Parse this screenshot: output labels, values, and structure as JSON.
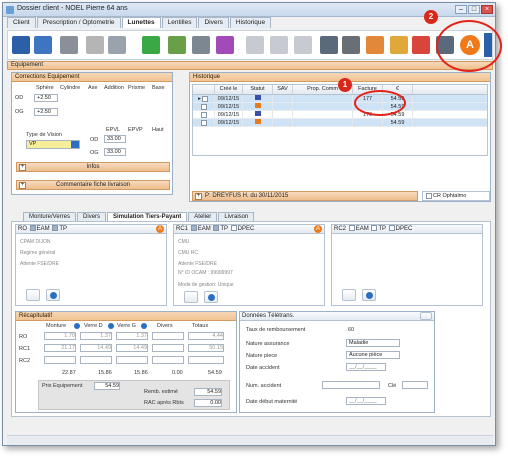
{
  "window": {
    "title": "Dossier client - NOEL Pierre 64 ans"
  },
  "tabs": [
    "Client",
    "Prescription / Optometrie",
    "Lunettes",
    "Lentilles",
    "Divers",
    "Historique"
  ],
  "equipment": {
    "label": "Equipement"
  },
  "corrections": {
    "title": "Corrections Equipement",
    "cols": [
      "Sphère",
      "Cylindre",
      "Axe",
      "Addition",
      "Prisme",
      "Base"
    ],
    "od": "OD",
    "og": "OG",
    "od_sphere": "+2.50",
    "og_sphere": "+2.50",
    "vision_label": "Type de Vision",
    "vision_value": "VP",
    "epvl": "EPVL",
    "epvp": "EPVP",
    "haut": "Haut",
    "od_epvl": "33.00",
    "og_epvl": "33.00",
    "infos": "Infos",
    "comment": "Commentaire fiche livraison"
  },
  "historique": {
    "title": "Historique",
    "cols": [
      "Créé le",
      "Statut",
      "SAV",
      "Prop. Comm",
      "Facture",
      "€"
    ],
    "rows": [
      {
        "date": "09/12/15",
        "facture": "177",
        "amount": "54.59"
      },
      {
        "date": "09/12/15",
        "facture": "",
        "amount": "54.59"
      },
      {
        "date": "09/12/15",
        "facture": "176",
        "amount": "54.59"
      },
      {
        "date": "09/12/15",
        "facture": "",
        "amount": "54.59"
      }
    ],
    "presc": "P: DREYFUS H. du 30/11/2015",
    "cr": "CR Ophtalmo"
  },
  "subtabs": [
    "Monture/Verres",
    "Divers",
    "Simulation Tiers-Payant",
    "Atelier",
    "Livraison"
  ],
  "ro": {
    "title": "RO",
    "eam": "EAM",
    "tp": "TP",
    "l1": "CPAM DIJON",
    "l2": "Regime général",
    "l3": "Attente FSE/DRE"
  },
  "rc1": {
    "title": "RC1",
    "eam": "EAM",
    "tp": "TP",
    "dpec": "DPEC",
    "l1": "CMU",
    "l2": "CMU RC",
    "l3": "Attente FSE/DRE",
    "l4": "N° ID OCAM : 99999997",
    "l5": "Mode de gestion: Unique"
  },
  "rc2": {
    "title": "RC2",
    "eam": "EAM",
    "tp": "TP",
    "dpec": "DPEC"
  },
  "recap": {
    "title": "Récapitulatif",
    "cols": [
      "Monture",
      "Verre D",
      "Verre G",
      "Divers",
      "Totaux"
    ],
    "rows": [
      {
        "label": "RO",
        "v": [
          "1.70",
          "1.37",
          "1.37",
          "",
          "4.44"
        ]
      },
      {
        "label": "RC1",
        "v": [
          "21.17",
          "14.49",
          "14.49",
          "",
          "50.15"
        ]
      },
      {
        "label": "RC2",
        "v": [
          "",
          "",
          "",
          "",
          ""
        ]
      }
    ],
    "totals": [
      "22.87",
      "15.86",
      "15.86",
      "0.00",
      "54.59"
    ],
    "prix_label": "Prix Equipement",
    "prix": "54.59",
    "remb_label": "Remb. estimé",
    "remb": "54.59",
    "rac_label": "RAC après Rbts",
    "rac": "0.00"
  },
  "teletrans": {
    "title": "Données Télétrans.",
    "taux_label": "Taux de remboursement",
    "taux": "60",
    "nature_label": "Nature assurance",
    "nature": "Maladie",
    "piece_label": "Nature piece",
    "piece": "Aucune pièce",
    "date_acc_label": "Date accident",
    "date_acc": "__/__/____",
    "num_acc_label": "Num. accident",
    "cle_label": "Clé",
    "mat_label": "Date début maternité",
    "mat": "__/__/____"
  },
  "annotations": {
    "one": "1",
    "two": "2"
  },
  "colors": {
    "accent": "#f2c494",
    "ring": "#e2231a",
    "orange": "#f07a1a"
  }
}
